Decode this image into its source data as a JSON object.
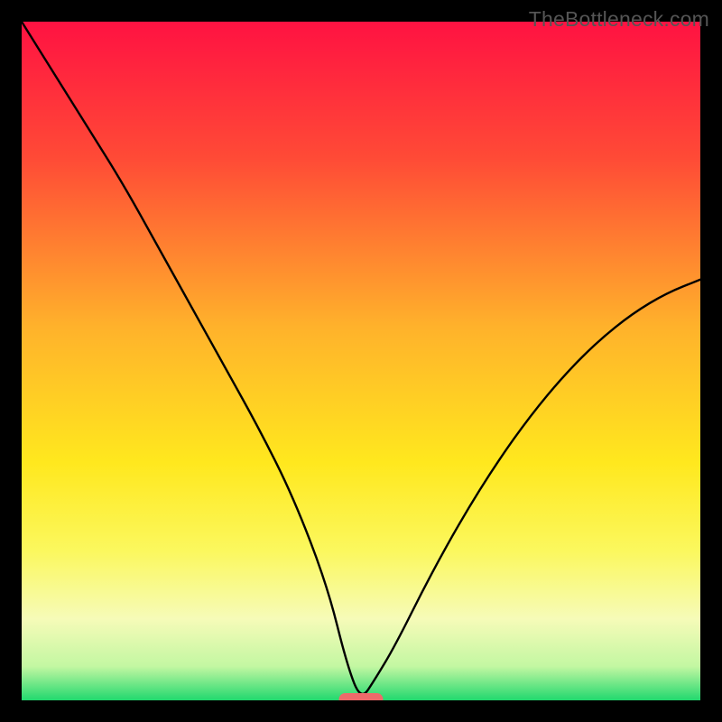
{
  "watermark": "TheBottleneck.com",
  "chart_data": {
    "type": "line",
    "title": "",
    "xlabel": "",
    "ylabel": "",
    "xlim": [
      0,
      100
    ],
    "ylim": [
      0,
      100
    ],
    "x": [
      0,
      5,
      10,
      15,
      20,
      25,
      30,
      35,
      40,
      45,
      48,
      50,
      52,
      55,
      60,
      65,
      70,
      75,
      80,
      85,
      90,
      95,
      100
    ],
    "values": [
      100,
      92,
      84,
      76,
      67,
      58,
      49,
      40,
      30,
      17,
      5,
      0,
      3,
      8,
      18,
      27,
      35,
      42,
      48,
      53,
      57,
      60,
      62
    ],
    "optimum_marker": {
      "x": 50,
      "width": 6.5,
      "color": "#ef6a6a"
    },
    "gradient_stops": [
      {
        "offset": 0.0,
        "color": "#ff1242"
      },
      {
        "offset": 0.2,
        "color": "#ff4a36"
      },
      {
        "offset": 0.45,
        "color": "#ffb22b"
      },
      {
        "offset": 0.65,
        "color": "#ffe81e"
      },
      {
        "offset": 0.78,
        "color": "#fbf85e"
      },
      {
        "offset": 0.88,
        "color": "#f6fbb8"
      },
      {
        "offset": 0.95,
        "color": "#c3f7a2"
      },
      {
        "offset": 1.0,
        "color": "#21d86e"
      }
    ],
    "frame_color": "#000000",
    "frame_thickness_px": 24
  }
}
